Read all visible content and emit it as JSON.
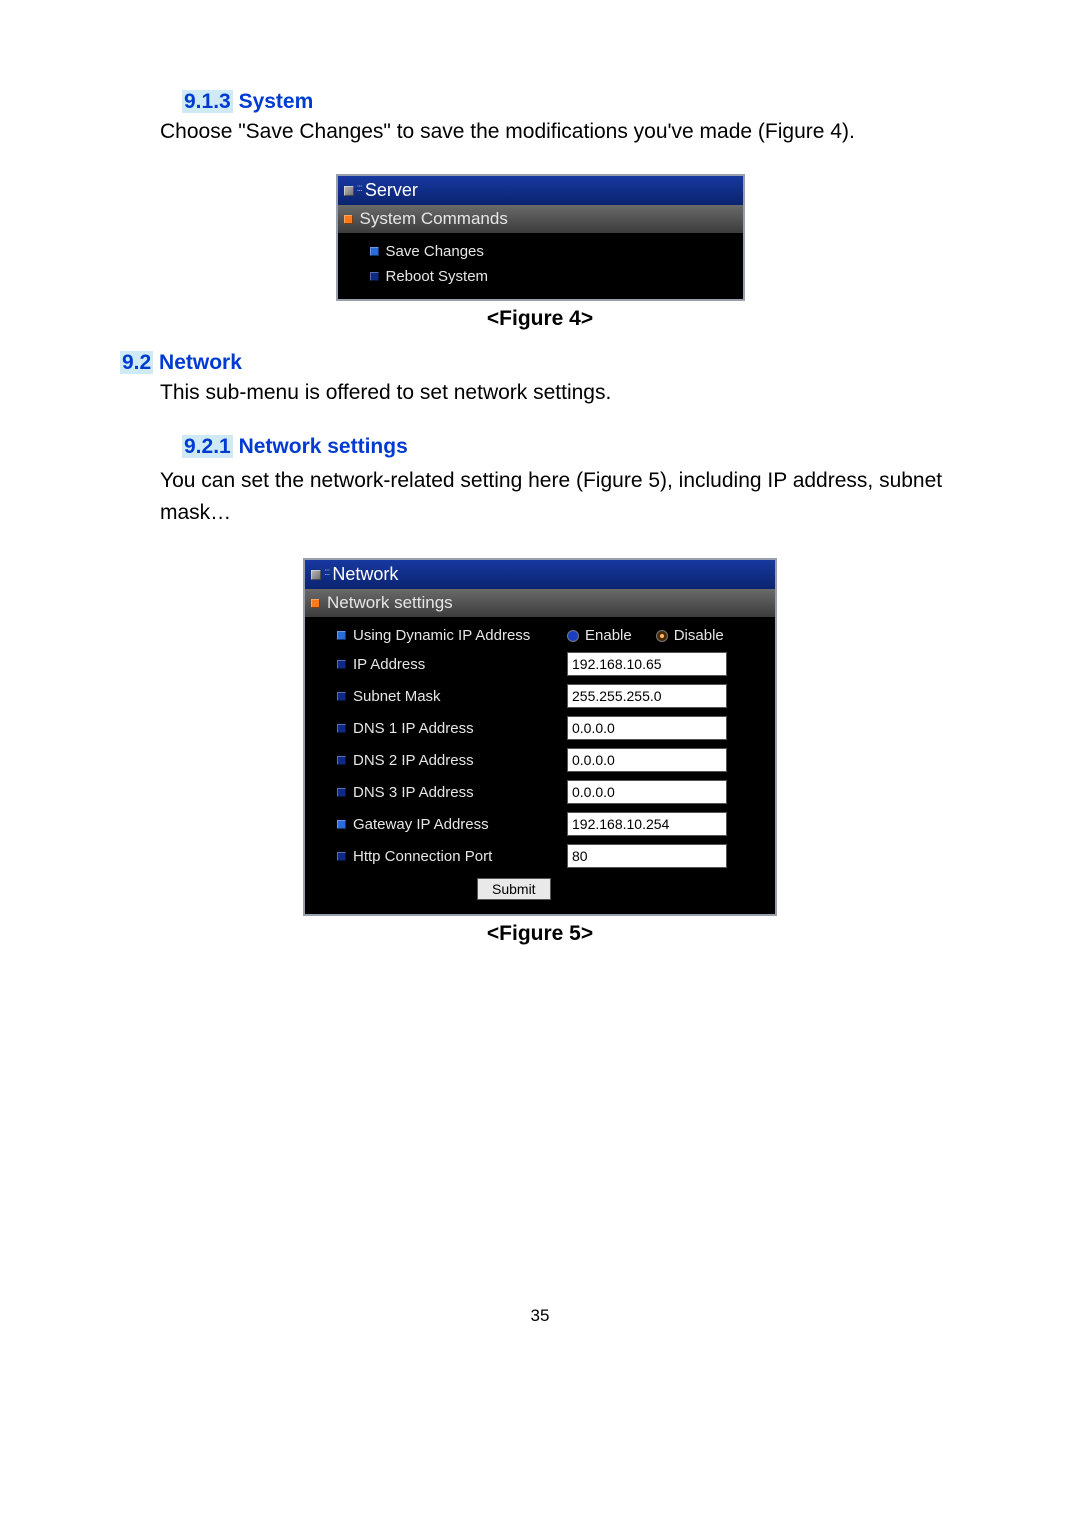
{
  "sections": {
    "s913": {
      "num": "9.1.3",
      "title": "System",
      "body": "Choose \"Save Changes\" to save the modifications you've made (Figure 4)."
    },
    "s92": {
      "num": "9.2",
      "title": "Network",
      "body": "This sub-menu is offered to set network settings."
    },
    "s921": {
      "num": "9.2.1",
      "title": "Network settings",
      "body": "You can set the network-related setting here (Figure 5), including IP address, subnet mask…"
    }
  },
  "figure4": {
    "caption": "<Figure 4>",
    "panel_title": "Server",
    "sub_title": "System Commands",
    "items": [
      "Save Changes",
      "Reboot System"
    ]
  },
  "figure5": {
    "caption": "<Figure 5>",
    "panel_title": "Network",
    "sub_title": "Network settings",
    "dhcp": {
      "label": "Using Dynamic IP Address",
      "enable": "Enable",
      "disable": "Disable"
    },
    "fields": {
      "ip": {
        "label": "IP Address",
        "value": "192.168.10.65"
      },
      "subnet": {
        "label": "Subnet Mask",
        "value": "255.255.255.0"
      },
      "dns1": {
        "label": "DNS 1 IP Address",
        "value": "0.0.0.0"
      },
      "dns2": {
        "label": "DNS 2 IP Address",
        "value": "0.0.0.0"
      },
      "dns3": {
        "label": "DNS 3 IP Address",
        "value": "0.0.0.0"
      },
      "gateway": {
        "label": "Gateway IP Address",
        "value": "192.168.10.254"
      },
      "http": {
        "label": "Http Connection Port",
        "value": "80"
      }
    },
    "submit": "Submit"
  },
  "page_number": "35"
}
